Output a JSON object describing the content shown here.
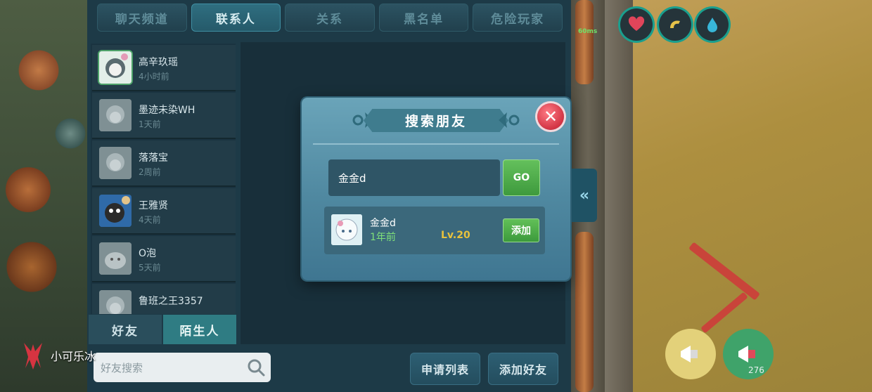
{
  "tabs": [
    {
      "label": "聊天频道",
      "active": false
    },
    {
      "label": "联系人",
      "active": true
    },
    {
      "label": "关系",
      "active": false
    },
    {
      "label": "黑名单",
      "active": false
    },
    {
      "label": "危险玩家",
      "active": false
    }
  ],
  "contacts": [
    {
      "name": "高辛玖瑶",
      "time": "4小时前"
    },
    {
      "name": "墨迹未染WH",
      "time": "1天前"
    },
    {
      "name": "落落宝",
      "time": "2周前"
    },
    {
      "name": "王雅贤",
      "time": "4天前"
    },
    {
      "name": "O泡",
      "time": "5天前"
    },
    {
      "name": "鲁班之王3357",
      "time": ""
    }
  ],
  "bottom_tabs": [
    {
      "label": "好友",
      "active": false
    },
    {
      "label": "陌生人",
      "active": true
    }
  ],
  "friend_search": {
    "placeholder": "好友搜索"
  },
  "footer_buttons": {
    "apply_list": "申请列表",
    "add_friend": "添加好友"
  },
  "modal": {
    "title": "搜索朋友",
    "input_value": "金金d",
    "go_label": "GO",
    "result": {
      "name": "金金d",
      "time": "1年前",
      "level": "Lv.20",
      "add_label": "添加"
    }
  },
  "hud": {
    "ping": "60ms",
    "broadcast_count": "276"
  },
  "watermark": "小可乐冰",
  "colors": {
    "panel": "#1d3a47",
    "modal": "#4f88a0",
    "accent_green": "#4caf50",
    "level_gold": "#e8c23c"
  }
}
